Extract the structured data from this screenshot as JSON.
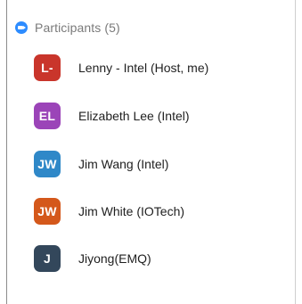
{
  "header": {
    "title": "Participants (5)",
    "icon": "zoom-logo-icon"
  },
  "participants": [
    {
      "initials": "L-",
      "name": "Lenny - Intel (Host, me)",
      "color": "#c9352b"
    },
    {
      "initials": "EL",
      "name": "Elizabeth Lee (Intel)",
      "color": "#9b44b8"
    },
    {
      "initials": "JW",
      "name": "Jim Wang (Intel)",
      "color": "#2f88c8"
    },
    {
      "initials": "JW",
      "name": "Jim White (IOTech)",
      "color": "#d4581b"
    },
    {
      "initials": "J",
      "name": "Jiyong(EMQ)",
      "color": "#33475b"
    }
  ]
}
